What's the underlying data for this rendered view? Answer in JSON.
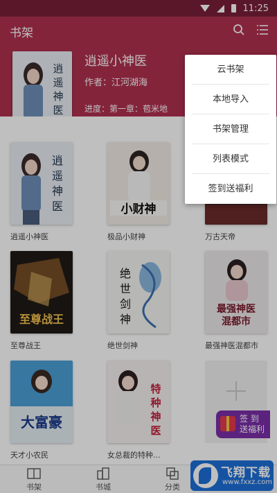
{
  "status_bar": {
    "time": "11:25"
  },
  "app_bar": {
    "title": "书架",
    "search_icon": "search-icon",
    "menu_icon": "list-menu-icon"
  },
  "colors": {
    "primary": "#b0314f",
    "status_bar": "#7a1f38",
    "promo": "#7a2ea8",
    "watermark": "#1d6fd8"
  },
  "current_book": {
    "title": "逍遥小神医",
    "author": "作者：江河湖海",
    "progress": "进度：第一章：苞米地",
    "cover_text": "逍遥神医"
  },
  "books": [
    {
      "title": "逍遥小神医",
      "cover_text": "逍遥神医"
    },
    {
      "title": "极品小财神",
      "cover_text": "小财神"
    },
    {
      "title": "万古天帝",
      "cover_text": ""
    },
    {
      "title": "至尊战王",
      "cover_text": "至尊战王"
    },
    {
      "title": "绝世剑神",
      "cover_text": "绝世剑神"
    },
    {
      "title": "最强神医混都市",
      "cover_text": "最强神医混都市"
    },
    {
      "title": "天才小农民",
      "cover_text": "大富豪"
    },
    {
      "title": "女总裁的特种...",
      "cover_text": "特种神医"
    }
  ],
  "promo": {
    "line1": "签 到",
    "line2": "送福利"
  },
  "popup_menu": {
    "items": [
      "云书架",
      "本地导入",
      "书架管理",
      "列表模式",
      "签到送福利"
    ]
  },
  "bottom_nav": {
    "items": [
      "书架",
      "书城",
      "分类"
    ]
  },
  "watermark": {
    "title": "飞翔下载",
    "url": "www.fxxz.com"
  }
}
